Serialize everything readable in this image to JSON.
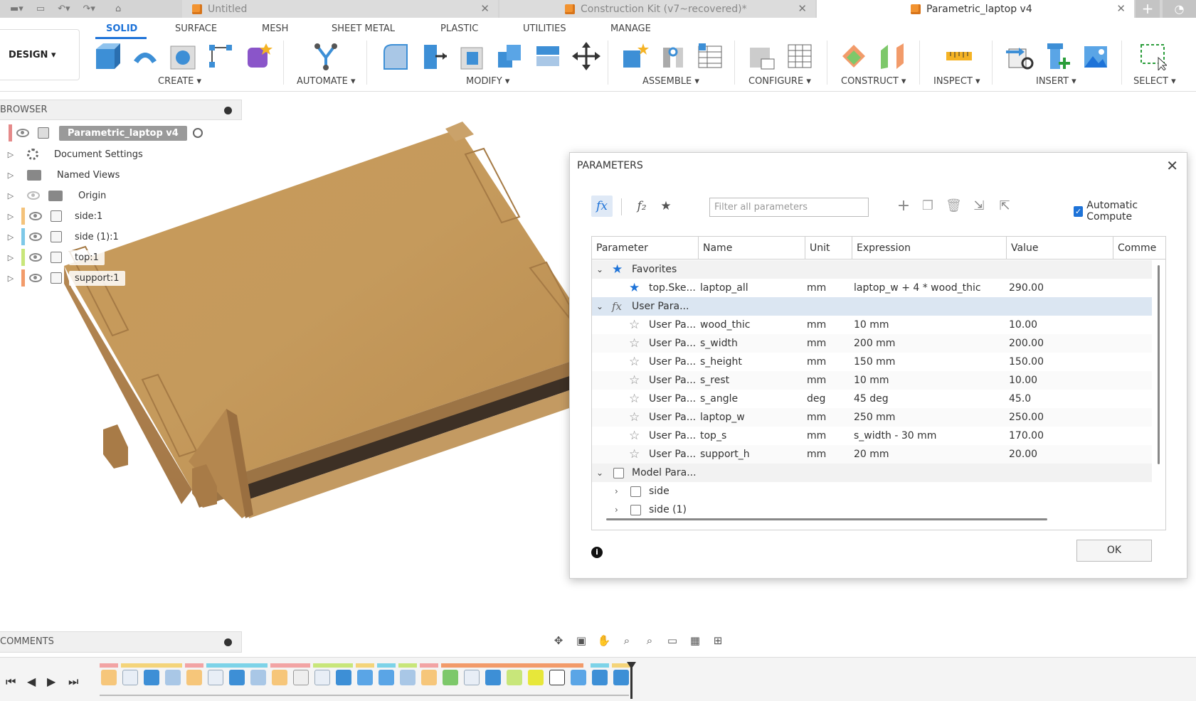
{
  "tabs": [
    {
      "label": "Untitled",
      "active": false
    },
    {
      "label": "Construction Kit (v7~recovered)*",
      "active": false
    },
    {
      "label": "Parametric_laptop v4",
      "active": true
    }
  ],
  "ribbon": {
    "workspace": "DESIGN ▾",
    "tabs": [
      "SOLID",
      "SURFACE",
      "MESH",
      "SHEET METAL",
      "PLASTIC",
      "UTILITIES",
      "MANAGE"
    ],
    "groups": [
      "CREATE ▾",
      "AUTOMATE ▾",
      "MODIFY ▾",
      "ASSEMBLE ▾",
      "CONFIGURE ▾",
      "CONSTRUCT ▾",
      "INSPECT ▾",
      "INSERT ▾",
      "SELECT ▾"
    ]
  },
  "browser": {
    "title": "BROWSER",
    "root": "Parametric_laptop v4",
    "items": [
      "Document Settings",
      "Named Views",
      "Origin",
      "side:1",
      "side (1):1",
      "top:1",
      "support:1"
    ],
    "colors": {
      "side1": "#f4c27a",
      "side11": "#7dc8e8",
      "top1": "#c8e67a",
      "support1": "#f29b6a"
    }
  },
  "parameters": {
    "title": "PARAMETERS",
    "filter_placeholder": "Filter all parameters",
    "auto_compute_label": "Automatic Compute",
    "auto_compute_checked": true,
    "columns": [
      "Parameter",
      "Name",
      "Unit",
      "Expression",
      "Value",
      "Comme"
    ],
    "groups": {
      "favorites": "Favorites",
      "user": "User Para...",
      "model": "Model Para..."
    },
    "favorites": [
      {
        "parameter": "top.Ske...",
        "name": "laptop_all",
        "unit": "mm",
        "expression": "laptop_w + 4 * wood_thic",
        "value": "290.00"
      }
    ],
    "user": [
      {
        "parameter": "User Pa...",
        "name": "wood_thic",
        "unit": "mm",
        "expression": "10 mm",
        "value": "10.00"
      },
      {
        "parameter": "User Pa...",
        "name": "s_width",
        "unit": "mm",
        "expression": "200 mm",
        "value": "200.00"
      },
      {
        "parameter": "User Pa...",
        "name": "s_height",
        "unit": "mm",
        "expression": "150 mm",
        "value": "150.00"
      },
      {
        "parameter": "User Pa...",
        "name": "s_rest",
        "unit": "mm",
        "expression": "10 mm",
        "value": "10.00"
      },
      {
        "parameter": "User Pa...",
        "name": "s_angle",
        "unit": "deg",
        "expression": "45 deg",
        "value": "45.0"
      },
      {
        "parameter": "User Pa...",
        "name": "laptop_w",
        "unit": "mm",
        "expression": "250 mm",
        "value": "250.00"
      },
      {
        "parameter": "User Pa...",
        "name": "top_s",
        "unit": "mm",
        "expression": "s_width - 30 mm",
        "value": "170.00"
      },
      {
        "parameter": "User Pa...",
        "name": "support_h",
        "unit": "mm",
        "expression": "20 mm",
        "value": "20.00"
      }
    ],
    "model": [
      "side",
      "side (1)"
    ],
    "ok_label": "OK",
    "info_glyph": "i"
  },
  "comments": {
    "title": "COMMENTS"
  },
  "icons": {
    "close": "✕",
    "expand": "▷",
    "collapse_chevron": "⌄",
    "star_filled": "★",
    "star_empty": "☆",
    "fx": "fx",
    "plus": "+"
  }
}
